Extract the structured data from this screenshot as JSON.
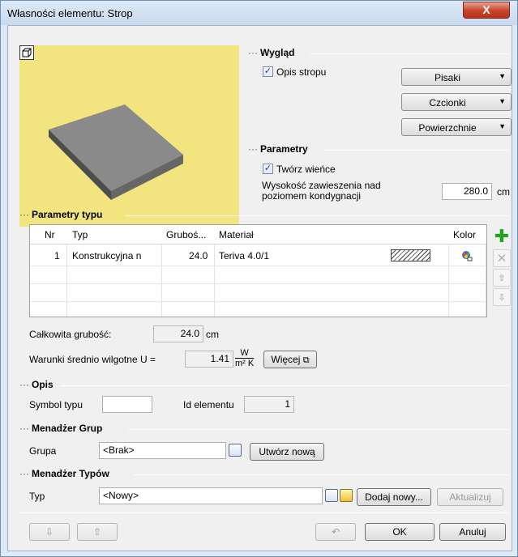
{
  "window": {
    "title": "Własności elementu: Strop",
    "close_glyph": "X"
  },
  "appearance": {
    "header": "Wygląd",
    "opis_checkbox": {
      "label": "Opis stropu",
      "checked": true
    },
    "pisaki": "Pisaki",
    "czcionki": "Czcionki",
    "powierzchnie": "Powierzchnie"
  },
  "parameters": {
    "header": "Parametry",
    "wience_checkbox": {
      "label": "Twórz wieńce",
      "checked": true
    },
    "height_label_1": "Wysokość zawieszenia nad",
    "height_label_2": "poziomem kondygnacji",
    "height_value": "280.0",
    "height_unit": "cm"
  },
  "type_params": {
    "header": "Parametry typu",
    "columns": [
      "Nr",
      "Typ",
      "Gruboś...",
      "Materiał",
      "Kolor"
    ],
    "rows": [
      {
        "nr": "1",
        "typ": "Konstrukcyjna n",
        "grubosc": "24.0",
        "material": "Teriva 4.0/1"
      }
    ],
    "total_label": "Całkowita grubość:",
    "total_value": "24.0",
    "total_unit": "cm",
    "u_label": "Warunki średnio wilgotne U =",
    "u_value": "1.41",
    "u_unit_num": "W",
    "u_unit_den": "m² K",
    "more_button": "Więcej"
  },
  "opis": {
    "header": "Opis",
    "symbol_label": "Symbol typu",
    "symbol_value": "",
    "id_label": "Id elementu",
    "id_value": "1"
  },
  "group_manager": {
    "header": "Menadżer Grup",
    "label": "Grupa",
    "value": "<Brak>",
    "create_button": "Utwórz nową"
  },
  "type_manager": {
    "header": "Menadżer Typów",
    "label": "Typ",
    "value": "<Nowy>",
    "add_button": "Dodaj nowy...",
    "update_button": "Aktualizuj"
  },
  "footer": {
    "ok": "OK",
    "cancel": "Anuluj"
  }
}
